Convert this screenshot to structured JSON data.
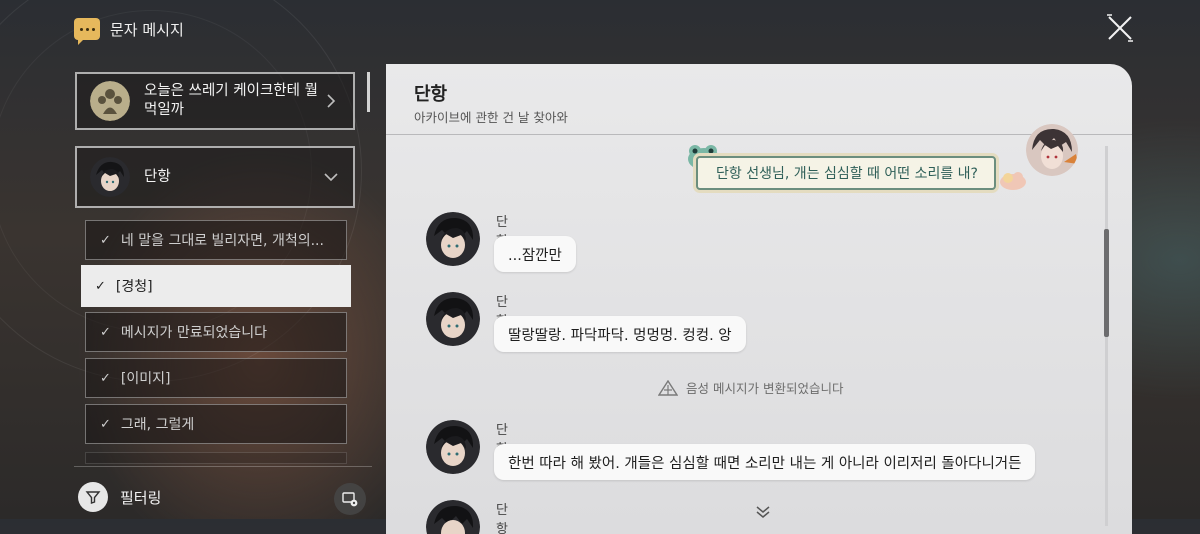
{
  "app": {
    "title": "문자 메시지"
  },
  "sidebar": {
    "conversations": [
      {
        "title": "오늘은 쓰레기 케이크한테 뭘 먹일까",
        "avatar": "group-avatar-icon"
      },
      {
        "title": "단항",
        "avatar": "dan-heng-avatar"
      }
    ],
    "threads": [
      {
        "label": "네 말을 그대로 빌리자면, 개척의...",
        "checked": true,
        "active": false
      },
      {
        "label": "[경청]",
        "checked": true,
        "active": true
      },
      {
        "label": "메시지가 만료되었습니다",
        "checked": true,
        "active": false
      },
      {
        "label": "[이미지]",
        "checked": true,
        "active": false
      },
      {
        "label": "그래, 그럴게",
        "checked": true,
        "active": false
      }
    ],
    "check_mark": "✓",
    "filter_label": "필터링"
  },
  "chat": {
    "contact_name": "단항",
    "contact_subtitle": "아카이브에 관한 건 날 찾아와",
    "outgoing": "단항 선생님, 개는 심심할 때 어떤 소리를 내?",
    "messages": [
      {
        "sender": "단항",
        "text": "...잠깐만"
      },
      {
        "sender": "단항",
        "text": "딸랑딸랑. 파닥파닥. 멍멍멍. 컹컹. 앙"
      },
      {
        "sender": "단항",
        "text": "한번 따라 해 봤어. 개들은 심심할 때면 소리만 내는 게 아니라 이리저리 돌아다니거든"
      },
      {
        "sender": "단항",
        "text": ""
      }
    ],
    "system_note": "음성 메시지가 변환되었습니다"
  },
  "colors": {
    "accent_gold": "#e6b85c",
    "outgoing_border": "#6b8e7e",
    "outgoing_text": "#2e5f58",
    "panel_bg": "#e9e9ea"
  }
}
